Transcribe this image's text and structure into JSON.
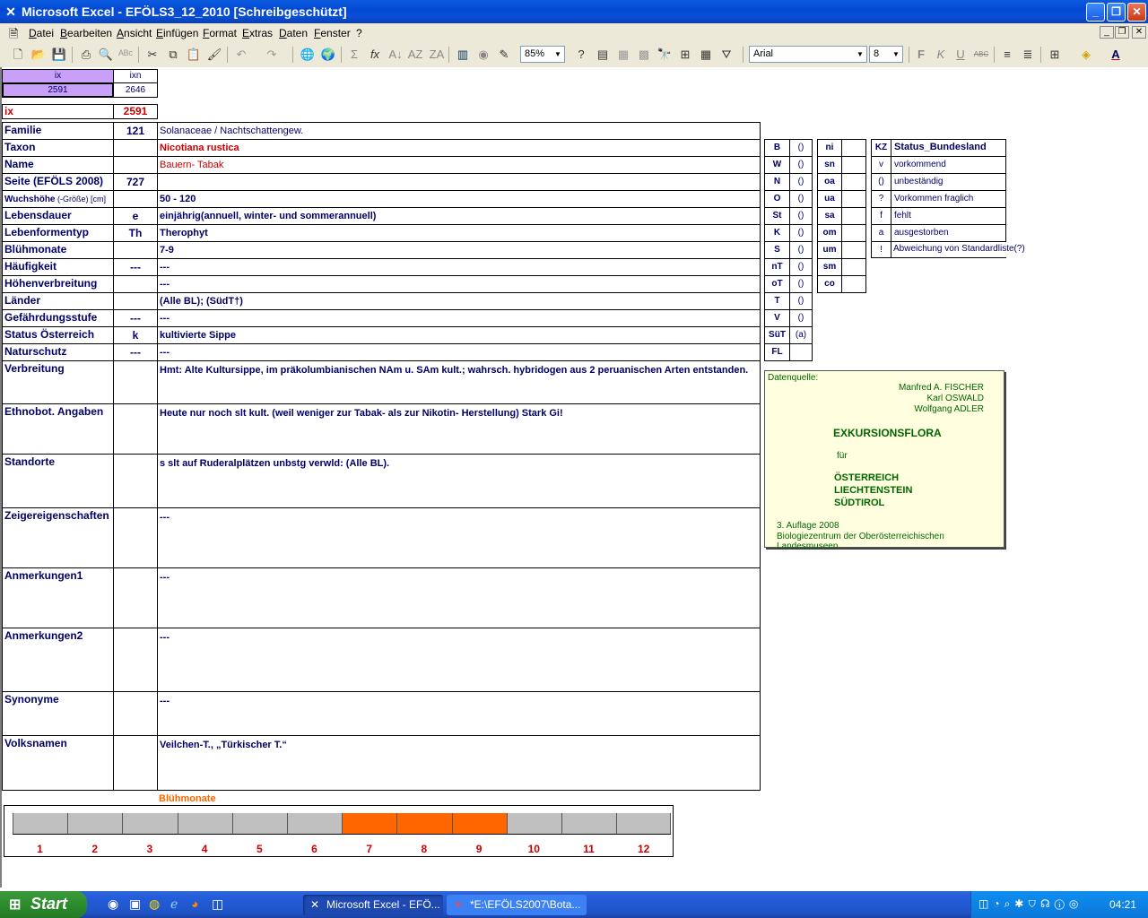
{
  "window": {
    "title": "Microsoft Excel - EFÖLS3_12_2010  [Schreibgeschützt]",
    "app_icon": "excel-icon"
  },
  "menu": [
    "Datei",
    "Bearbeiten",
    "Ansicht",
    "Einfügen",
    "Format",
    "Extras",
    "Daten",
    "Fenster",
    "?"
  ],
  "toolbar": {
    "zoom": "85%",
    "font": "Arial",
    "font_size": "8",
    "bold": "F",
    "italic": "K",
    "underline": "U",
    "strike": "ABC"
  },
  "header": {
    "ix_label": "ix",
    "ixn_label": "ixn",
    "ix_val": "2591",
    "ixn_val": "2646",
    "ix2_label": "ix",
    "ix2_val": "2591"
  },
  "rows": [
    {
      "label": "Familie",
      "mid": "121",
      "value": "Solanaceae  /  Nachtschattengew."
    },
    {
      "label": "Taxon",
      "mid": "",
      "value": "Nicotiana rustica"
    },
    {
      "label": "Name",
      "mid": "",
      "value": "Bauern- Tabak"
    },
    {
      "label": "Seite (EFÖLS 2008)",
      "mid": "727",
      "value": ""
    },
    {
      "label": "Wuchshöhe",
      "sub": " (-Größe) [cm]",
      "mid": "",
      "value": " 50 - 120"
    },
    {
      "label": "Lebensdauer",
      "mid": "e",
      "value": "einjährig(annuell, winter- und sommerannuell)"
    },
    {
      "label": "Lebenformentyp",
      "mid": "Th",
      "value": "Therophyt"
    },
    {
      "label": "Blühmonate",
      "mid": "",
      "value": " 7-9"
    },
    {
      "label": "Häufigkeit",
      "mid": "---",
      "value": " ---"
    },
    {
      "label": "Höhenverbreitung",
      "mid": "",
      "value": " ---"
    },
    {
      "label": "Länder",
      "mid": "",
      "value": "(Alle BL); (SüdT†)"
    },
    {
      "label": "Gefährdungsstufe",
      "mid": "---",
      "value": "   ---"
    },
    {
      "label": "Status Österreich",
      "mid": "k",
      "value": "kultivierte Sippe"
    },
    {
      "label": "Naturschutz",
      "mid": "---",
      "value": " ---"
    },
    {
      "label": "Verbreitung",
      "mid": "",
      "value": "Hmt: Alte Kultursippe, im präkolumbianischen NAm u. SAm kult.; wahrsch. hybridogen aus 2 peruanischen Arten entstanden."
    },
    {
      "label": "Ethnobot. Angaben",
      "mid": "",
      "value": "Heute nur noch slt kult. (weil weniger zur Tabak- als zur Nikotin- Herstellung)  Stark Gi!"
    },
    {
      "label": "Standorte",
      "mid": "",
      "value": "s slt auf Ruderalplätzen unbstg verwld: (Alle BL)."
    },
    {
      "label": "Zeigereigenschaften",
      "mid": "",
      "value": "---"
    },
    {
      "label": "Anmerkungen1",
      "mid": "",
      "value": "---"
    },
    {
      "label": "Anmerkungen2",
      "mid": "",
      "value": "---"
    },
    {
      "label": "Synonyme",
      "mid": "",
      "value": "---"
    },
    {
      "label": "Volksnamen",
      "mid": "",
      "value": "Veilchen-T., „Türkischer T.“"
    }
  ],
  "codes1": [
    [
      "B",
      "()"
    ],
    [
      "W",
      "()"
    ],
    [
      "N",
      "()"
    ],
    [
      "O",
      "()"
    ],
    [
      "St",
      "()"
    ],
    [
      "K",
      "()"
    ],
    [
      "S",
      "()"
    ],
    [
      "nT",
      "()"
    ],
    [
      "oT",
      "()"
    ],
    [
      "T",
      "()"
    ],
    [
      "V",
      "()"
    ],
    [
      "SüT",
      "(a)"
    ],
    [
      "FL",
      ""
    ]
  ],
  "codes2": [
    [
      "ni",
      ""
    ],
    [
      "sn",
      ""
    ],
    [
      "oa",
      ""
    ],
    [
      "ua",
      ""
    ],
    [
      "sa",
      ""
    ],
    [
      "om",
      ""
    ],
    [
      "um",
      ""
    ],
    [
      "sm",
      ""
    ],
    [
      "co",
      ""
    ]
  ],
  "legend": [
    [
      "KZ",
      "Status_Bundesland"
    ],
    [
      "v",
      "vorkommend"
    ],
    [
      "()",
      "unbeständig"
    ],
    [
      "?",
      "Vorkommen fraglich"
    ],
    [
      "f",
      "fehlt"
    ],
    [
      "a",
      "ausgestorben"
    ],
    [
      "!",
      "Abweichung von Standardliste(?)"
    ]
  ],
  "source": {
    "label": "Datenquelle:",
    "authors": [
      "Manfred A. FISCHER",
      "Karl OSWALD",
      "Wolfgang ADLER"
    ],
    "title": "EXKURSIONSFLORA",
    "fuer": "für",
    "countries": [
      "ÖSTERREICH",
      "LIECHTENSTEIN",
      "SÜDTIROL"
    ],
    "edition": "3. Auflage 2008",
    "publisher": "Biologiezentrum der Oberösterreichischen Landesmuseen"
  },
  "bloom": {
    "title": "Blühmonate",
    "months": [
      "1",
      "2",
      "3",
      "4",
      "5",
      "6",
      "7",
      "8",
      "9",
      "10",
      "11",
      "12"
    ],
    "active": [
      7,
      8,
      9
    ],
    "active_color": "#ff6600",
    "inactive_color": "#c0c0c0"
  },
  "taskbar": {
    "start": "Start",
    "tasks": [
      "Microsoft Excel - EFÖ...",
      "*E:\\EFÖLS2007\\Bota..."
    ],
    "clock": "04:21"
  }
}
